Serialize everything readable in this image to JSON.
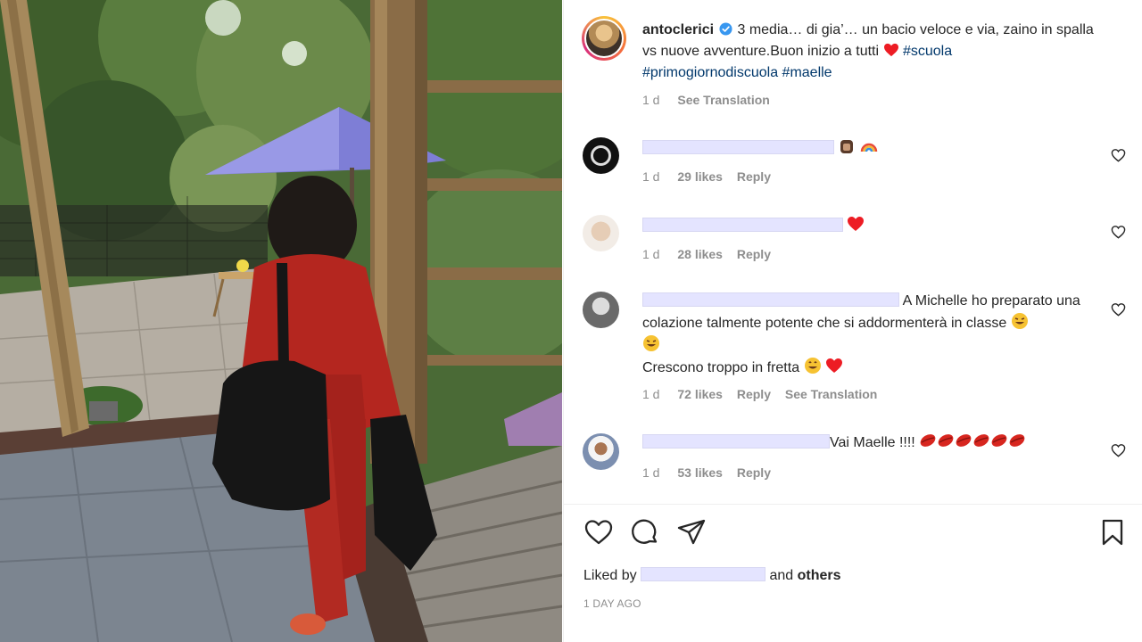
{
  "post": {
    "username": "antoclerici",
    "caption_text": "3 media… di gia’… un bacio veloce e via, zaino in spalla vs nuove avventure.Buon inizio a tutti",
    "hashtags": [
      "#scuola",
      "#primogiornodiscuola",
      "#maelle"
    ],
    "time": "1 d",
    "see_translation": "See Translation"
  },
  "comments": [
    {
      "text": "",
      "time": "1 d",
      "likes": "29 likes",
      "reply": "Reply"
    },
    {
      "text": "",
      "time": "1 d",
      "likes": "28 likes",
      "reply": "Reply"
    },
    {
      "text_line1": "A Michelle ho preparato una",
      "text_line2": "colazione talmente potente che si addormenterà in classe",
      "text_line3": "Crescono troppo in fretta",
      "time": "1 d",
      "likes": "72 likes",
      "reply": "Reply",
      "see_translation": "See Translation"
    },
    {
      "text": "Vai Maelle !!!!",
      "time": "1 d",
      "likes": "53 likes",
      "reply": "Reply"
    }
  ],
  "footer": {
    "liked_by_prefix": "Liked by",
    "liked_by_and": "and",
    "liked_by_others": "others",
    "posted_ago": "1 DAY AGO"
  },
  "icons": {
    "like": "heart-outline-icon",
    "comment": "comment-bubble-icon",
    "share": "paper-plane-icon",
    "save": "bookmark-icon"
  },
  "colors": {
    "hashtag": "#00376b",
    "muted": "#8e8e8e",
    "heart_red": "#ed1c24",
    "verified_blue": "#3897f0"
  }
}
